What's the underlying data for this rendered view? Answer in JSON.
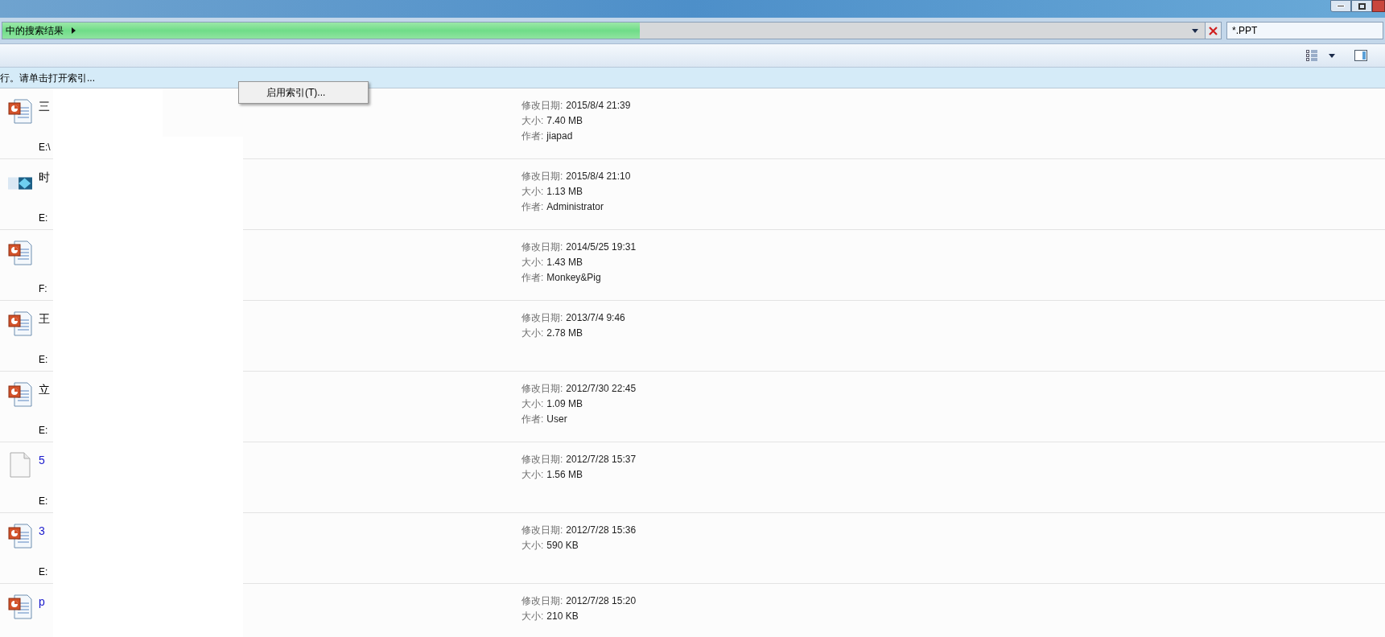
{
  "address_bar": {
    "breadcrumb": "中的搜索结果",
    "progress": {
      "level": 0.53
    }
  },
  "search": {
    "value": "*.PPT"
  },
  "info_bar": {
    "text": "行。请单击打开索引..."
  },
  "context_menu": {
    "items": [
      "启用索引(T)..."
    ]
  },
  "results": [
    {
      "kind": "ppt",
      "name": "三",
      "path": "E:\\",
      "details": [
        {
          "label": "修改日期:",
          "value": "2015/8/4 21:39"
        },
        {
          "label": "大小:",
          "value": "7.40 MB"
        },
        {
          "label": "作者:",
          "value": "jiapad"
        }
      ]
    },
    {
      "kind": "image",
      "name": "时",
      "path": "E:",
      "details": [
        {
          "label": "修改日期:",
          "value": "2015/8/4 21:10"
        },
        {
          "label": "大小:",
          "value": "1.13 MB"
        },
        {
          "label": "作者:",
          "value": "Administrator"
        }
      ]
    },
    {
      "kind": "ppt",
      "path": "F:",
      "details": [
        {
          "label": "修改日期:",
          "value": "2014/5/25 19:31"
        },
        {
          "label": "大小:",
          "value": "1.43 MB"
        },
        {
          "label": "作者:",
          "value": "Monkey&Pig"
        }
      ]
    },
    {
      "kind": "ppt",
      "name": "王",
      "path": "E:",
      "details": [
        {
          "label": "修改日期:",
          "value": "2013/7/4 9:46"
        },
        {
          "label": "大小:",
          "value": "2.78 MB"
        }
      ]
    },
    {
      "kind": "ppt",
      "name": "立",
      "path": "E:",
      "details": [
        {
          "label": "修改日期:",
          "value": "2012/7/30 22:45"
        },
        {
          "label": "大小:",
          "value": "1.09 MB"
        },
        {
          "label": "作者:",
          "value": "User"
        }
      ]
    },
    {
      "kind": "blank",
      "name": "5",
      "color": "#1a1acc",
      "path": "E:",
      "details": [
        {
          "label": "修改日期:",
          "value": "2012/7/28 15:37"
        },
        {
          "label": "大小:",
          "value": "1.56 MB"
        }
      ]
    },
    {
      "kind": "ppt",
      "name": "3",
      "color": "#1a1acc",
      "path": "E:",
      "details": [
        {
          "label": "修改日期:",
          "value": "2012/7/28 15:36"
        },
        {
          "label": "大小:",
          "value": "590 KB"
        }
      ]
    },
    {
      "kind": "ppt",
      "name": "p",
      "color": "#1a1acc",
      "details": [
        {
          "label": "修改日期:",
          "value": "2012/7/28 15:20"
        },
        {
          "label": "大小:",
          "value": "210 KB"
        }
      ]
    }
  ]
}
